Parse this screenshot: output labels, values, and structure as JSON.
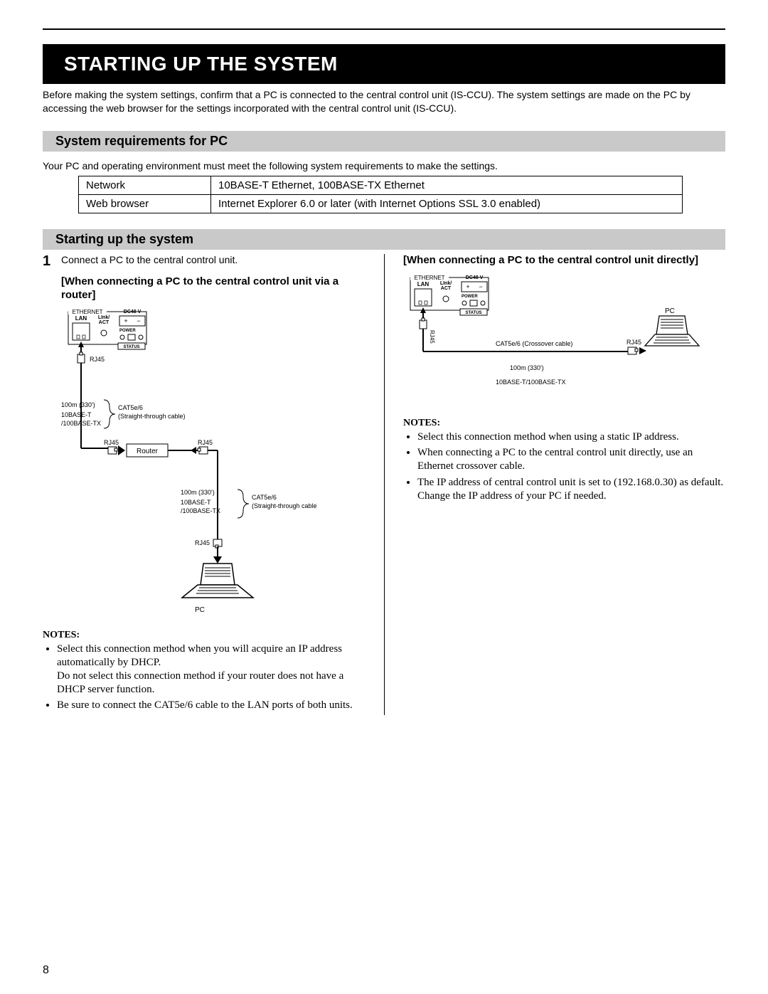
{
  "page_number": "8",
  "title": "STARTING UP THE SYSTEM",
  "intro": "Before making the system settings, confirm that a PC is connected to the central control unit (IS-CCU). The system settings are made on the PC by accessing the web browser for the settings incorporated with the central control unit (IS-CCU).",
  "sections": {
    "req": {
      "heading": "System requirements for PC",
      "caption": "Your PC and operating environment must meet the following system requirements to make the settings.",
      "rows": [
        {
          "label": "Network",
          "value": "10BASE-T Ethernet, 100BASE-TX Ethernet"
        },
        {
          "label": "Web browser",
          "value": "Internet Explorer 6.0 or later (with Internet Options SSL 3.0 enabled)"
        }
      ]
    },
    "startup": {
      "heading": "Starting up the system",
      "step1": "Connect a PC to the central control unit.",
      "router": {
        "heading": "[When connecting a PC to the central control unit via a router]",
        "notes_heading": "NOTES:",
        "notes": [
          "Select this connection method when you will acquire an IP address automatically by DHCP.\nDo not select this connection method if your router does not have a DHCP server function.",
          "Be sure to connect the CAT5e/6 cable to the LAN ports of both units."
        ]
      },
      "direct": {
        "heading": "[When connecting a PC to the central control unit directly]",
        "notes_heading": "NOTES:",
        "notes": [
          "Select this connection method when using a static IP address.",
          "When connecting a PC to the central control unit directly, use an Ethernet crossover cable.",
          "The IP address of central control unit is set to (192.168.0.30) as default. Change the IP address of your PC if needed."
        ]
      }
    }
  },
  "diagram": {
    "ethernet": "ETHERNET",
    "lan": "LAN",
    "link_act": "LInk/\nACT",
    "dc48": "DC48 V",
    "power": "POWER",
    "plus": "+",
    "minus": "−",
    "status": "STATUS",
    "rj45": "RJ45",
    "router": "Router",
    "pc": "PC",
    "dist": "100m (330')",
    "spec": "10BASE-T\n/100BASE-TX",
    "spec_single": "10BASE-T/100BASE-TX",
    "cat_straight": "CAT5e/6\n(Straight-through cable)",
    "cat_cross": "CAT5e/6 (Crossover cable)"
  }
}
